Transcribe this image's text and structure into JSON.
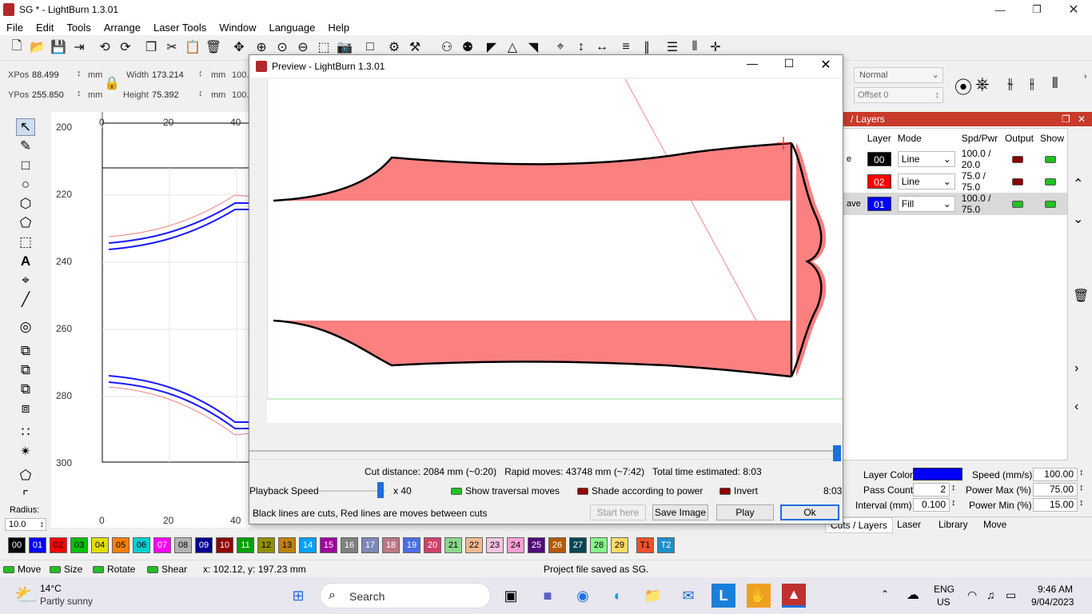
{
  "app": {
    "title": "SG * - LightBurn 1.3.01"
  },
  "menu": [
    "File",
    "Edit",
    "Tools",
    "Arrange",
    "Laser Tools",
    "Window",
    "Language",
    "Help"
  ],
  "position": {
    "xpos_label": "XPos",
    "xpos": "88.499",
    "ypos_label": "YPos",
    "ypos": "255.850",
    "unit": "mm",
    "width_label": "Width",
    "width": "173.214",
    "height_label": "Height",
    "height": "75.392",
    "scale_partial": "100."
  },
  "shape_props": {
    "mode": "Normal",
    "offset": "Offset 0"
  },
  "canvas": {
    "vruler": [
      "200",
      "220",
      "240",
      "260",
      "280",
      "300"
    ],
    "hruler": [
      "0",
      "20",
      "40"
    ],
    "bruler": [
      "0",
      "20",
      "40"
    ],
    "radius_label": "Radius:",
    "radius": "10.0"
  },
  "preview": {
    "title": "Preview - LightBurn 1.3.01",
    "stats": "Cut distance: 2084 mm (~0:20)   Rapid moves: 43748 mm (~7:42)   Total time estimated: 8:03",
    "playback_label": "Playback Speed",
    "playback_mult": "x 40",
    "show_traversal": "Show traversal moves",
    "shade_power": "Shade according to power",
    "invert": "Invert",
    "time": "8:03",
    "legend": "Black lines are cuts, Red lines are moves between cuts",
    "start_here": "Start here",
    "save_image": "Save Image",
    "play": "Play",
    "ok": "Ok"
  },
  "layers": {
    "panel_title": "/ Layers",
    "headers": [
      "Layer",
      "Mode",
      "Spd/Pwr",
      "Output",
      "Show"
    ],
    "rows": [
      {
        "num": "00",
        "color": "#000000",
        "mode": "Line",
        "spdpwr": "100.0 / 20.0",
        "name": "e",
        "output": "off",
        "show": "on"
      },
      {
        "num": "02",
        "color": "#ff0000",
        "mode": "Line",
        "spdpwr": "75.0 / 75.0",
        "name": "",
        "output": "off",
        "show": "on"
      },
      {
        "num": "01",
        "color": "#0000ff",
        "mode": "Fill",
        "spdpwr": "100.0 / 75.0",
        "name": "ave",
        "output": "on",
        "show": "on"
      }
    ],
    "layer_color_label": "Layer Color",
    "layer_color": "#0000ff",
    "speed_label": "Speed (mm/s)",
    "speed": "100.00",
    "pass_label": "Pass Count",
    "pass": "2",
    "power_max_label": "Power Max (%)",
    "power_max": "75.00",
    "interval_label": "Interval (mm)",
    "interval": "0.100",
    "power_min_label": "Power Min (%)",
    "power_min": "15.00",
    "tabs": [
      "Cuts / Layers",
      "Laser",
      "Library",
      "Move"
    ]
  },
  "palette": [
    {
      "n": "00",
      "c": "#000000",
      "t": "#fff"
    },
    {
      "n": "01",
      "c": "#0000ff",
      "t": "#fff"
    },
    {
      "n": "02",
      "c": "#ff0000",
      "t": "#000"
    },
    {
      "n": "03",
      "c": "#00c000",
      "t": "#000"
    },
    {
      "n": "04",
      "c": "#e0e000",
      "t": "#000"
    },
    {
      "n": "05",
      "c": "#ff8000",
      "t": "#000"
    },
    {
      "n": "06",
      "c": "#00d0d0",
      "t": "#000"
    },
    {
      "n": "07",
      "c": "#ff00ff",
      "t": "#fff"
    },
    {
      "n": "08",
      "c": "#b4b4b4",
      "t": "#000"
    },
    {
      "n": "09",
      "c": "#000090",
      "t": "#fff"
    },
    {
      "n": "10",
      "c": "#900000",
      "t": "#fff"
    },
    {
      "n": "11",
      "c": "#00a000",
      "t": "#fff"
    },
    {
      "n": "12",
      "c": "#909000",
      "t": "#000"
    },
    {
      "n": "13",
      "c": "#c08000",
      "t": "#000"
    },
    {
      "n": "14",
      "c": "#00a0ff",
      "t": "#fff"
    },
    {
      "n": "15",
      "c": "#a000a0",
      "t": "#fff"
    },
    {
      "n": "16",
      "c": "#808080",
      "t": "#fff"
    },
    {
      "n": "17",
      "c": "#7d87b9",
      "t": "#fff"
    },
    {
      "n": "18",
      "c": "#bb7784",
      "t": "#fff"
    },
    {
      "n": "19",
      "c": "#4a6fe3",
      "t": "#fff"
    },
    {
      "n": "20",
      "c": "#d33f6a",
      "t": "#fff"
    },
    {
      "n": "21",
      "c": "#8cd78c",
      "t": "#000"
    },
    {
      "n": "22",
      "c": "#f0b98d",
      "t": "#000"
    },
    {
      "n": "23",
      "c": "#f6c4e1",
      "t": "#000"
    },
    {
      "n": "24",
      "c": "#fa9ed4",
      "t": "#000"
    },
    {
      "n": "25",
      "c": "#500a78",
      "t": "#fff"
    },
    {
      "n": "26",
      "c": "#b45a00",
      "t": "#fff"
    },
    {
      "n": "27",
      "c": "#004754",
      "t": "#fff"
    },
    {
      "n": "28",
      "c": "#86fa88",
      "t": "#000"
    },
    {
      "n": "29",
      "c": "#ffdb66",
      "t": "#000"
    },
    {
      "n": "T1",
      "c": "#f05028",
      "t": "#000"
    },
    {
      "n": "T2",
      "c": "#1e90c8",
      "t": "#fff"
    }
  ],
  "status": {
    "move": "Move",
    "size": "Size",
    "rotate": "Rotate",
    "shear": "Shear",
    "coords": "x: 102.12, y: 197.23 mm",
    "message": "Project file saved as SG."
  },
  "taskbar": {
    "temp": "14°C",
    "weather": "Partly sunny",
    "search": "Search",
    "lang1": "ENG",
    "lang2": "US",
    "time": "9:46 AM",
    "date": "9/04/2023"
  }
}
